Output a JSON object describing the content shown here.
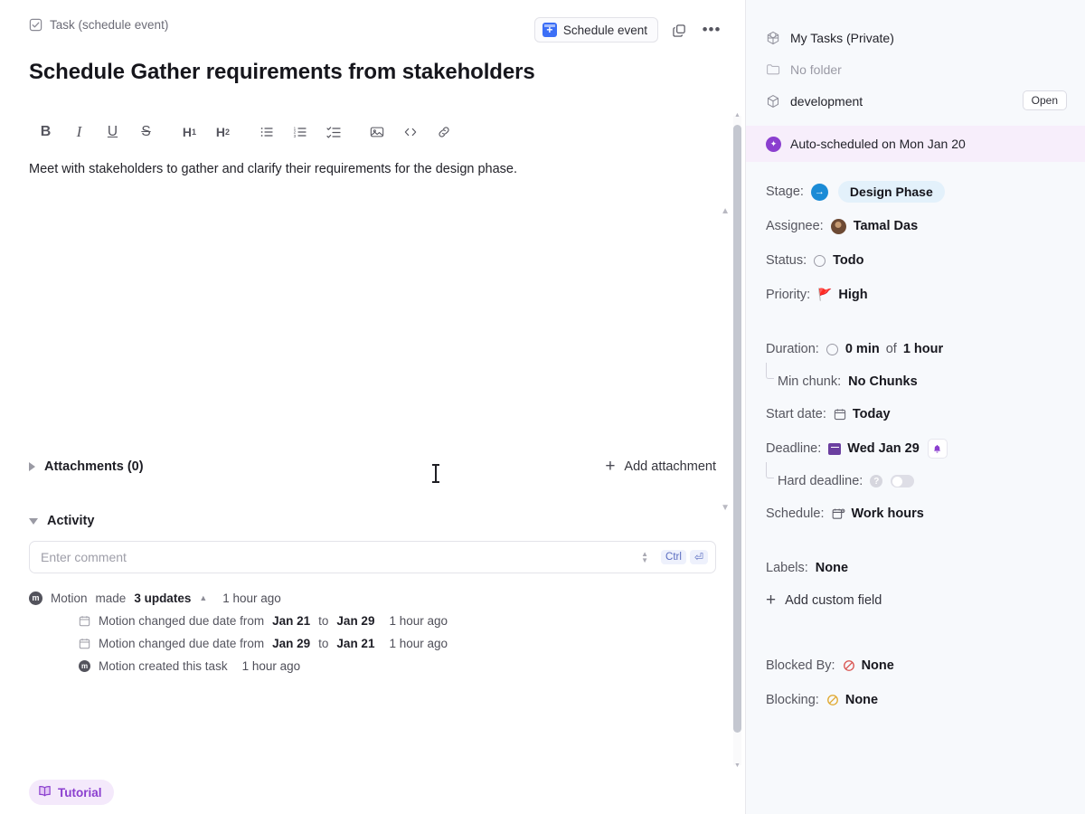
{
  "breadcrumb": {
    "label": "Task (schedule event)",
    "icon": "task-check-icon"
  },
  "topbar": {
    "schedule_event_label": "Schedule event",
    "duplicate_icon": "duplicate-icon",
    "more_icon": "more-options-icon"
  },
  "task": {
    "title": "Schedule Gather requirements from stakeholders",
    "description": "Meet with stakeholders to gather and clarify their requirements for the design phase."
  },
  "editor_toolbar": [
    {
      "name": "bold",
      "glyph": "B"
    },
    {
      "name": "italic",
      "glyph": "I"
    },
    {
      "name": "underline",
      "glyph": "U"
    },
    {
      "name": "strikethrough",
      "glyph": "S"
    },
    {
      "name": "heading-1",
      "glyph": "H1"
    },
    {
      "name": "heading-2",
      "glyph": "H2"
    },
    {
      "name": "bullet-list",
      "glyph": "list"
    },
    {
      "name": "numbered-list",
      "glyph": "ordered-list"
    },
    {
      "name": "checklist",
      "glyph": "check-list"
    },
    {
      "name": "image",
      "glyph": "image"
    },
    {
      "name": "code",
      "glyph": "</>"
    },
    {
      "name": "link",
      "glyph": "link"
    }
  ],
  "attachments": {
    "title": "Attachments (0)",
    "add_label": "Add attachment"
  },
  "activity": {
    "title": "Activity",
    "comment_placeholder": "Enter comment",
    "kbd_ctrl": "Ctrl",
    "kbd_enter": "⏎",
    "summary": {
      "author": "Motion",
      "made": "made",
      "updates": "3 updates",
      "time": "1 hour ago"
    },
    "entries": [
      {
        "icon": "calendar-icon",
        "prefix": "Motion changed due date from",
        "from": "Jan 21",
        "mid": "to",
        "to": "Jan 29",
        "time": "1 hour ago"
      },
      {
        "icon": "calendar-icon",
        "prefix": "Motion changed due date from",
        "from": "Jan 29",
        "mid": "to",
        "to": "Jan 21",
        "time": "1 hour ago"
      },
      {
        "icon": "motion-icon",
        "prefix": "Motion created this task",
        "from": "",
        "mid": "",
        "to": "",
        "time": "1 hour ago"
      }
    ]
  },
  "tutorial": {
    "label": "Tutorial",
    "icon": "book-icon"
  },
  "sidebar": {
    "workspace": {
      "label": "My Tasks (Private)",
      "icon": "workspace-cube-icon"
    },
    "folder": {
      "label": "No folder",
      "icon": "folder-icon"
    },
    "project": {
      "label": "development",
      "icon": "project-box-icon",
      "open_label": "Open"
    },
    "auto_scheduled": {
      "label": "Auto-scheduled on Mon Jan 20",
      "icon": "auto-schedule-icon"
    },
    "fields": {
      "stage": {
        "label": "Stage:",
        "value": "Design Phase",
        "icon": "stage-arrow-icon"
      },
      "assignee": {
        "label": "Assignee:",
        "value": "Tamal Das",
        "icon": "avatar"
      },
      "status": {
        "label": "Status:",
        "value": "Todo",
        "icon": "status-circle-icon"
      },
      "priority": {
        "label": "Priority:",
        "value": "High",
        "icon": "red-flag-icon"
      },
      "duration": {
        "label": "Duration:",
        "value": "0 min",
        "of": "of",
        "total": "1 hour",
        "icon": "duration-circle-icon"
      },
      "min_chunk": {
        "label": "Min chunk:",
        "value": "No Chunks"
      },
      "start_date": {
        "label": "Start date:",
        "value": "Today",
        "icon": "calendar-icon"
      },
      "deadline": {
        "label": "Deadline:",
        "value": "Wed Jan 29",
        "icon": "deadline-calendar-icon",
        "bell_icon": "bell-icon"
      },
      "hard_deadline": {
        "label": "Hard deadline:",
        "help_icon": "help-icon",
        "toggle": "off"
      },
      "schedule": {
        "label": "Schedule:",
        "value": "Work hours",
        "icon": "schedule-calendar-icon"
      },
      "labels": {
        "label": "Labels:",
        "value": "None"
      },
      "add_custom_field": {
        "label": "Add custom field",
        "icon": "plus-icon"
      },
      "blocked_by": {
        "label": "Blocked By:",
        "value": "None",
        "icon": "blocked-icon"
      },
      "blocking": {
        "label": "Blocking:",
        "value": "None",
        "icon": "blocking-icon"
      }
    }
  },
  "colors": {
    "accent_blue": "#3b6ef6",
    "purple": "#8b3fcf",
    "stage_chip_bg": "#e3f1fb",
    "sidebar_bg": "#f7f9fc",
    "banner_bg": "#f7eefb",
    "priority_red": "#e03030"
  }
}
